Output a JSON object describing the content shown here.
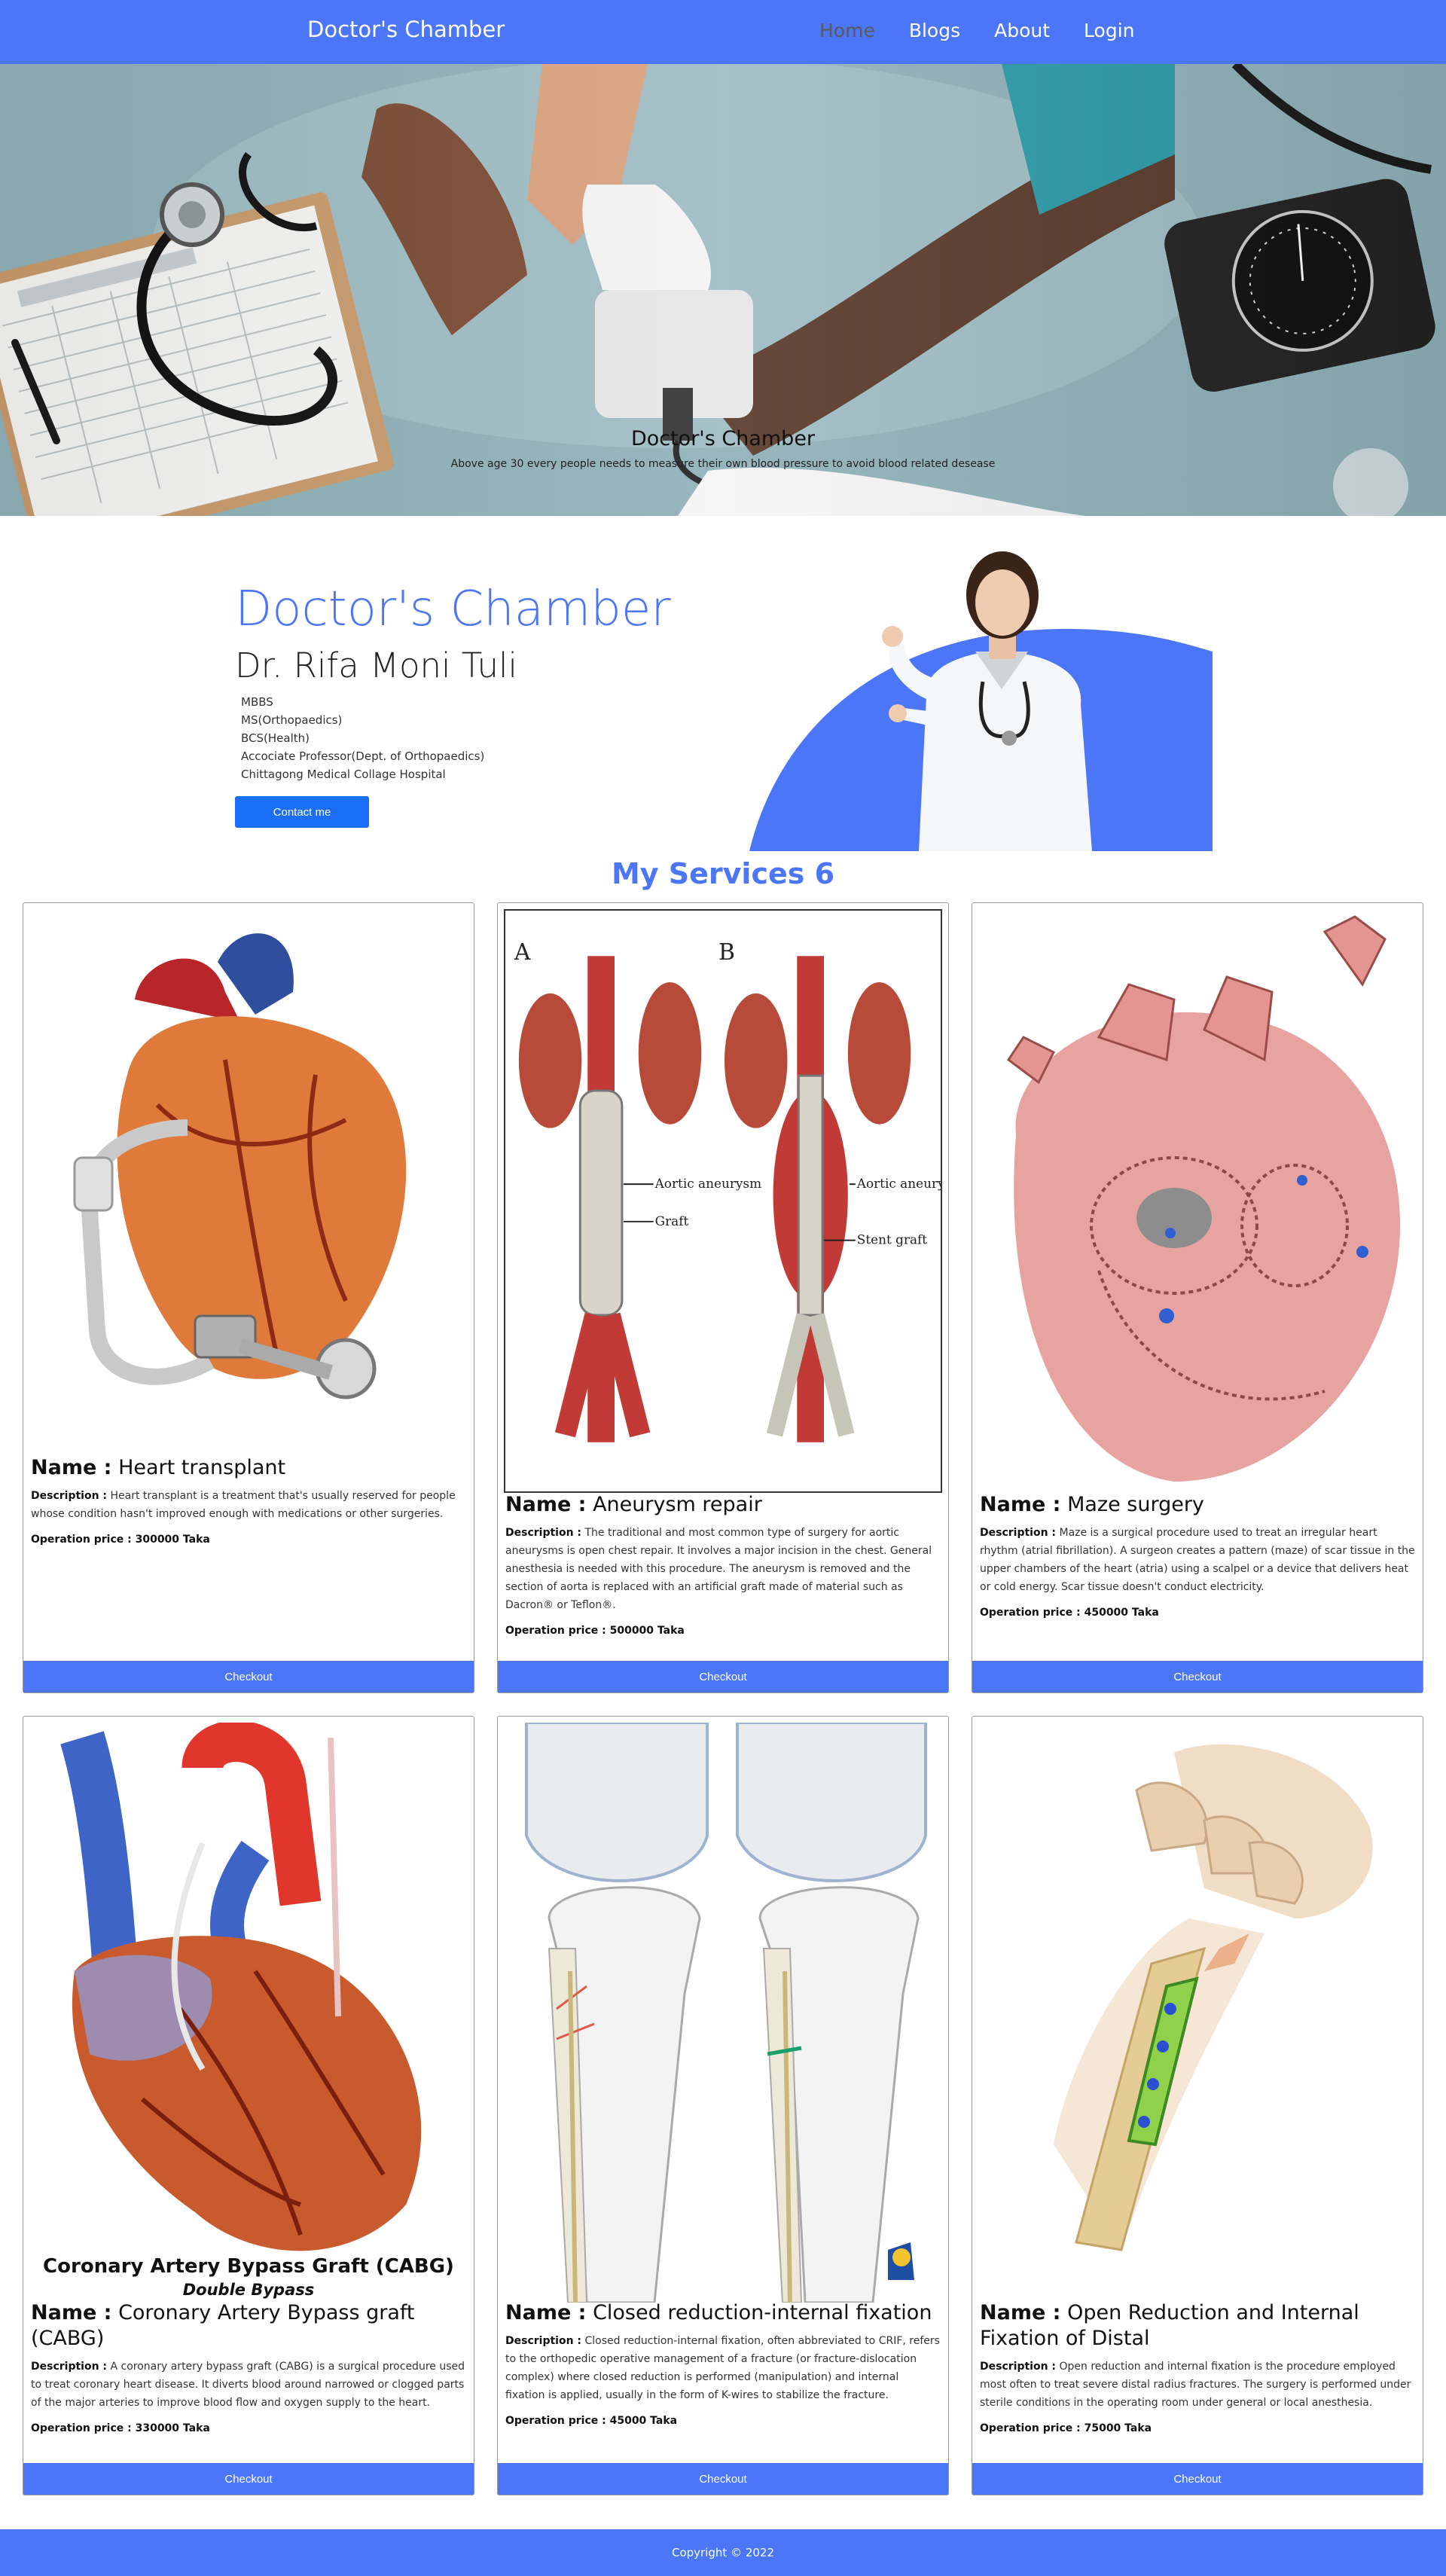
{
  "navbar": {
    "brand": "Doctor's Chamber",
    "links": [
      {
        "label": "Home",
        "active": true
      },
      {
        "label": "Blogs",
        "active": false
      },
      {
        "label": "About",
        "active": false
      },
      {
        "label": "Login",
        "active": false
      }
    ]
  },
  "hero": {
    "title": "Doctor's Chamber",
    "subtitle": "Above age 30 every people needs to measure their own blood pressure to avoid blood related desease"
  },
  "profile": {
    "title": "Doctor's Chamber",
    "name": "Dr. Rifa Moni Tuli",
    "qualifications": [
      "MBBS",
      "MS(Orthopaedics)",
      "BCS(Health)",
      "Accociate Professor(Dept. of Orthopaedics)",
      "Chittagong Medical Collage Hospital"
    ],
    "contact_label": "Contact me"
  },
  "services": {
    "title": "My Services 6",
    "name_prefix": "Name :",
    "desc_prefix": "Description :",
    "price_prefix": "Operation price :",
    "checkout_label": "Checkout",
    "items": [
      {
        "name": "Heart transplant",
        "description": "Heart transplant is a treatment that's usually reserved for people whose condition hasn't improved enough with medications or other surgeries.",
        "price": "300000 Taka",
        "image_labels": []
      },
      {
        "name": "Aneurysm repair",
        "description": "The traditional and most common type of surgery for aortic aneurysms is open chest repair. It involves a major incision in the chest. General anesthesia is needed with this procedure. The aneurysm is removed and the section of aorta is replaced with an artificial graft made of material such as Dacron® or Teflon®.",
        "price": "500000 Taka",
        "image_labels": [
          "A",
          "B",
          "Aortic aneurysm",
          "Graft",
          "Aortic aneurysm",
          "Stent graft"
        ]
      },
      {
        "name": "Maze surgery",
        "description": "Maze is a surgical procedure used to treat an irregular heart rhythm (atrial fibrillation). A surgeon creates a pattern (maze) of scar tissue in the upper chambers of the heart (atria) using a scalpel or a device that delivers heat or cold energy. Scar tissue doesn't conduct electricity.",
        "price": "450000 Taka",
        "image_labels": []
      },
      {
        "name": "Coronary Artery Bypass graft (CABG)",
        "description": "A coronary artery bypass graft (CABG) is a surgical procedure used to treat coronary heart disease. It diverts blood around narrowed or clogged parts of the major arteries to improve blood flow and oxygen supply to the heart.",
        "price": "330000 Taka",
        "image_labels": [
          "Coronary Artery Bypass Graft (CABG)",
          "Double Bypass"
        ]
      },
      {
        "name": "Closed reduction-internal fixation",
        "description": "Closed reduction-internal fixation, often abbreviated to CRIF, refers to the orthopedic operative management of a fracture (or fracture-dislocation complex) where closed reduction is performed (manipulation) and internal fixation is applied, usually in the form of K-wires to stabilize the fracture.",
        "price": "45000 Taka",
        "image_labels": []
      },
      {
        "name": "Open Reduction and Internal Fixation of Distal",
        "description": "Open reduction and internal fixation is the procedure employed most often to treat severe distal radius fractures. The surgery is performed under sterile conditions in the operating room under general or local anesthesia.",
        "price": "75000 Taka",
        "image_labels": []
      }
    ]
  },
  "footer": {
    "copyright": "Copyright © 2022"
  },
  "colors": {
    "primary": "#4b76f7",
    "contact_button": "#1a6ef7",
    "active_nav": "#5a5a5a"
  }
}
